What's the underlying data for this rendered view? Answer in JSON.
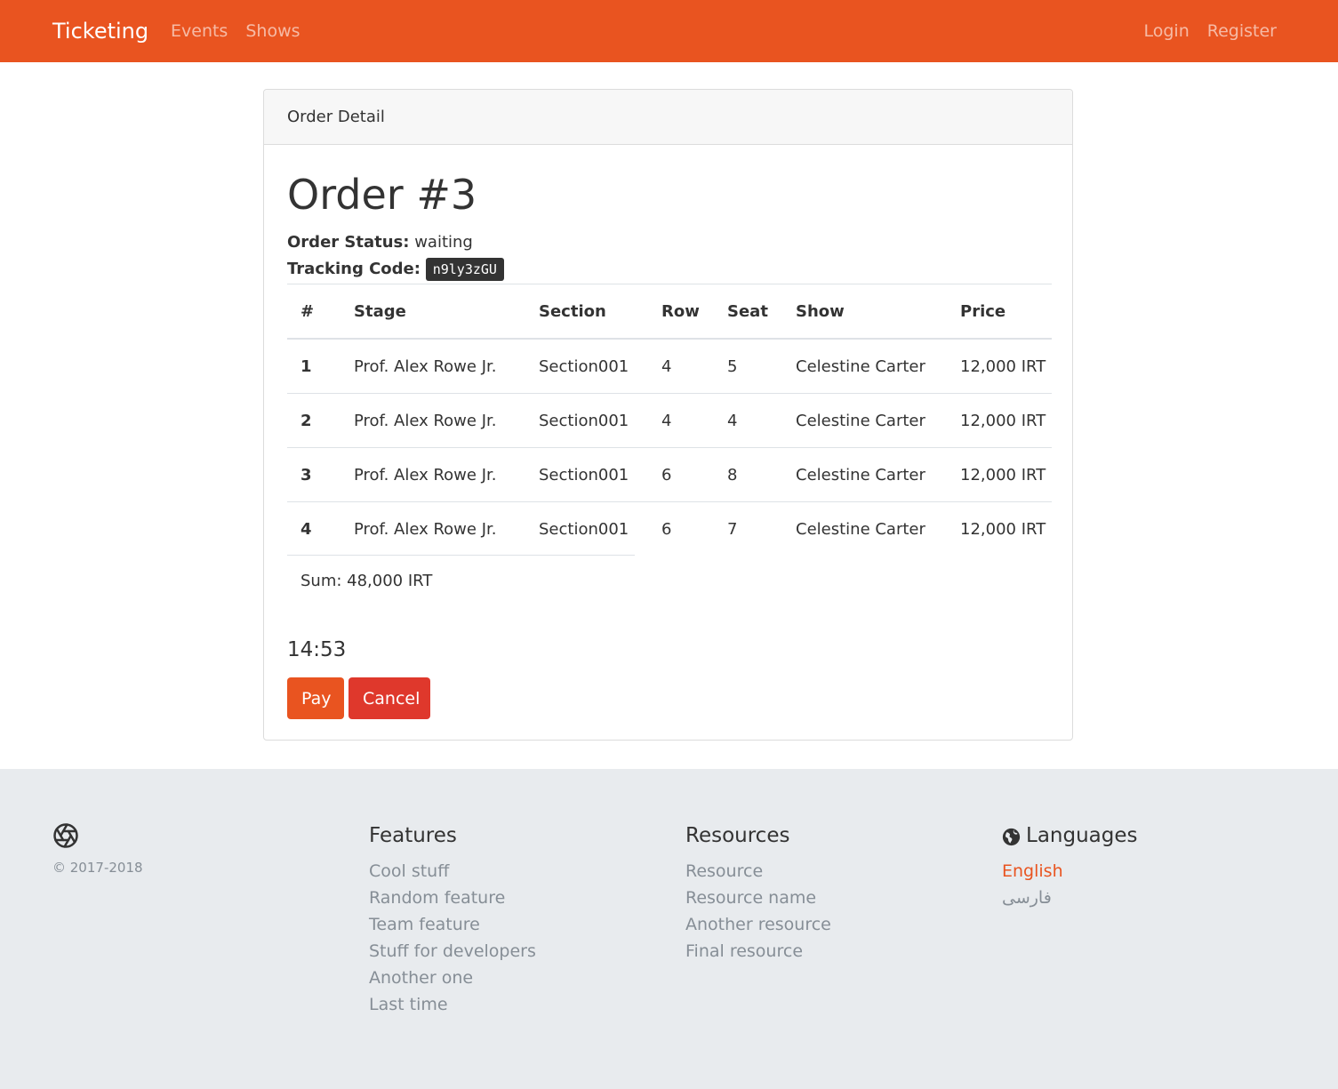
{
  "navbar": {
    "brand": "Ticketing",
    "left_links": [
      "Events",
      "Shows"
    ],
    "right_links": [
      "Login",
      "Register"
    ],
    "color": "#e95420"
  },
  "card": {
    "header": "Order Detail",
    "title": "Order #3",
    "status_label": "Order Status:",
    "status_value": "waiting",
    "tracking_label": "Tracking Code:",
    "tracking_value": "n9ly3zGU"
  },
  "table": {
    "headers": [
      "#",
      "Stage",
      "Section",
      "Row",
      "Seat",
      "Show",
      "Price"
    ],
    "rows": [
      [
        "1",
        "Prof. Alex Rowe Jr.",
        "Section001",
        "4",
        "5",
        "Celestine Carter",
        "12,000 IRT"
      ],
      [
        "2",
        "Prof. Alex Rowe Jr.",
        "Section001",
        "4",
        "4",
        "Celestine Carter",
        "12,000 IRT"
      ],
      [
        "3",
        "Prof. Alex Rowe Jr.",
        "Section001",
        "6",
        "8",
        "Celestine Carter",
        "12,000 IRT"
      ],
      [
        "4",
        "Prof. Alex Rowe Jr.",
        "Section001",
        "6",
        "7",
        "Celestine Carter",
        "12,000 IRT"
      ]
    ],
    "sum": "Sum: 48,000 IRT"
  },
  "timer": "14:53",
  "actions": {
    "pay": "Pay",
    "cancel": "Cancel"
  },
  "footer": {
    "copyright": "© 2017-2018",
    "features": {
      "title": "Features",
      "items": [
        "Cool stuff",
        "Random feature",
        "Team feature",
        "Stuff for developers",
        "Another one",
        "Last time"
      ]
    },
    "resources": {
      "title": "Resources",
      "items": [
        "Resource",
        "Resource name",
        "Another resource",
        "Final resource"
      ]
    },
    "languages": {
      "title": "Languages",
      "items": [
        "English",
        "فارسی"
      ]
    }
  }
}
